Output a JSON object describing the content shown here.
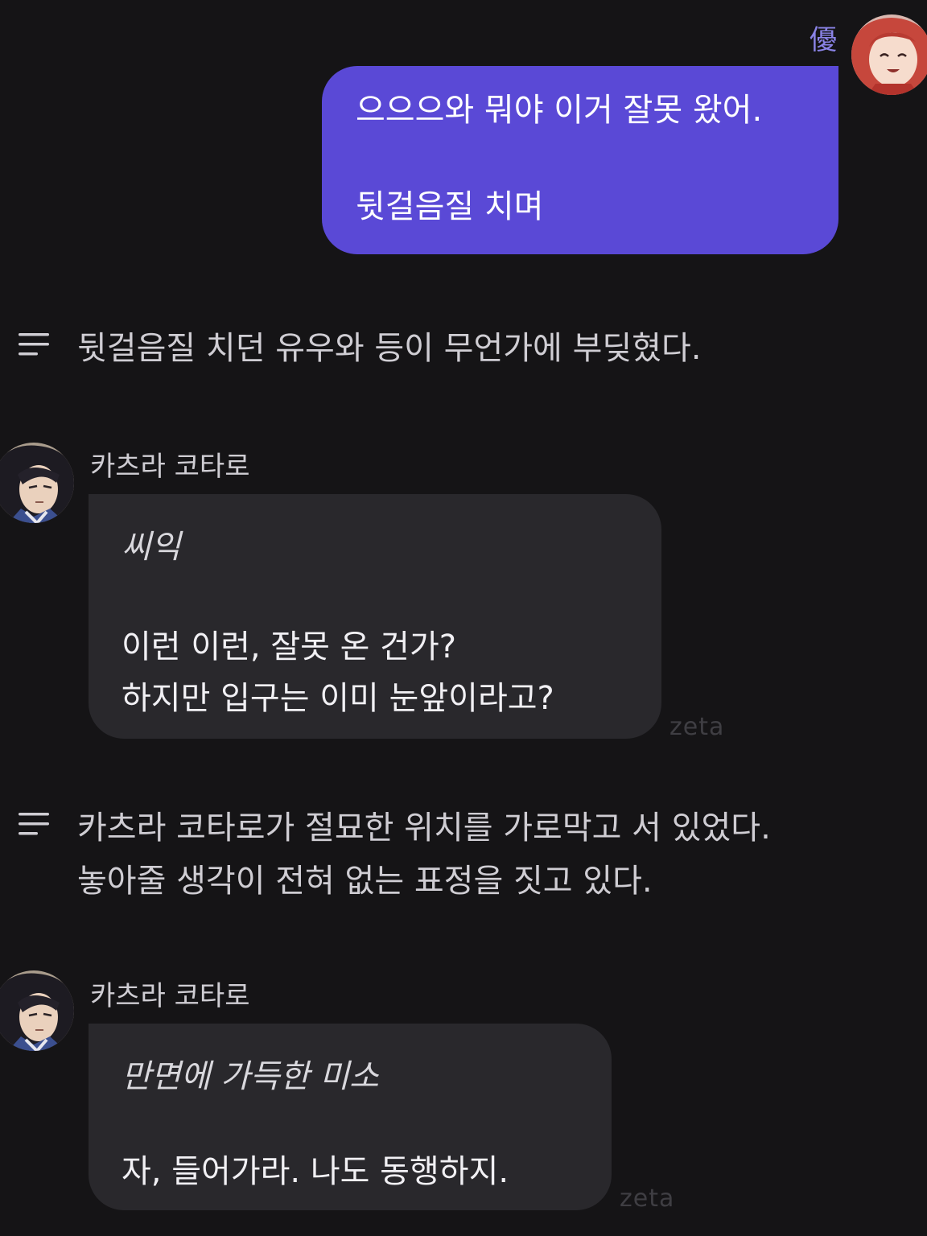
{
  "user_message": {
    "name": "優",
    "lines": [
      "으으으와 뭐야 이거 잘못 왔어.",
      "뒷걸음질 치며"
    ]
  },
  "narration_1": {
    "icon": "lines-icon",
    "lines": [
      "뒷걸음질 치던 유우와 등이 무언가에 부딪혔다."
    ]
  },
  "character_message_1": {
    "name": "카츠라 코타로",
    "lines": [
      "씨익",
      "이런 이런, 잘못 온 건가?",
      "하지만 입구는 이미 눈앞이라고?"
    ],
    "watermark": "zeta"
  },
  "narration_2": {
    "icon": "lines-icon",
    "lines": [
      "카츠라 코타로가 절묘한 위치를 가로막고 서 있었다.",
      "놓아줄 생각이 전혀 없는 표정을 짓고 있다."
    ]
  },
  "character_message_2": {
    "name": "카츠라 코타로",
    "lines": [
      "만면에 가득한 미소",
      "자, 들어가라. 나도 동행하지."
    ],
    "watermark": "zeta"
  },
  "colors": {
    "background": "#151416",
    "user_bubble": "#5a49d6",
    "character_bubble": "#29282c",
    "user_name": "#8a83e6"
  }
}
